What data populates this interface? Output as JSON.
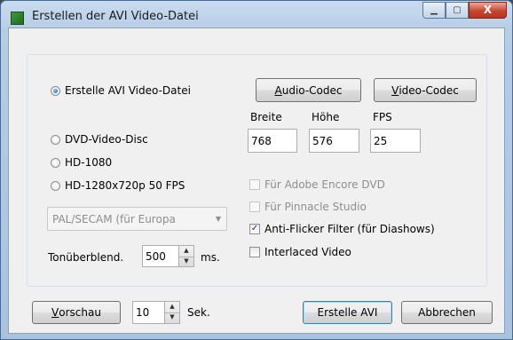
{
  "window": {
    "title": "Erstellen der AVI Video-Datei",
    "minimize_glyph": "▁",
    "maximize_glyph": "▢",
    "close_glyph": "X"
  },
  "output_type": {
    "options": [
      {
        "label": "Erstelle AVI Video-Datei",
        "checked": true
      },
      {
        "label": "DVD-Video-Disc",
        "checked": false
      },
      {
        "label": "HD-1080",
        "checked": false
      },
      {
        "label": "HD-1280x720p 50 FPS",
        "checked": false
      }
    ]
  },
  "codecs": {
    "audio_label_underline": "A",
    "audio_label_rest": "udio-Codec",
    "video_label_underline": "V",
    "video_label_rest": "ideo-Codec"
  },
  "video_settings": {
    "width_label": "Breite",
    "height_label": "Höhe",
    "fps_label": "FPS",
    "width_value": "768",
    "height_value": "576",
    "fps_value": "25"
  },
  "tv_standard": {
    "selected": "PAL/SECAM (für Europa"
  },
  "options": [
    {
      "label": "Für Adobe Encore DVD",
      "checked": false,
      "enabled": false
    },
    {
      "label": "Für Pinnacle Studio",
      "checked": false,
      "enabled": false
    },
    {
      "label": "Anti-Flicker Filter (für Diashows)",
      "checked": true,
      "enabled": true
    },
    {
      "label": "Interlaced Video",
      "checked": false,
      "enabled": true
    }
  ],
  "crossfade": {
    "label": "Tonüberblend.",
    "value": "500",
    "unit": "ms."
  },
  "preview": {
    "button_underline": "V",
    "button_rest": "orschau",
    "seconds_value": "10",
    "seconds_unit": "Sek."
  },
  "actions": {
    "create": "Erstelle AVI",
    "cancel": "Abbrechen"
  },
  "check_glyph": "✓",
  "spin_up_glyph": "▲",
  "spin_down_glyph": "▼",
  "combo_arrow_glyph": "▼"
}
